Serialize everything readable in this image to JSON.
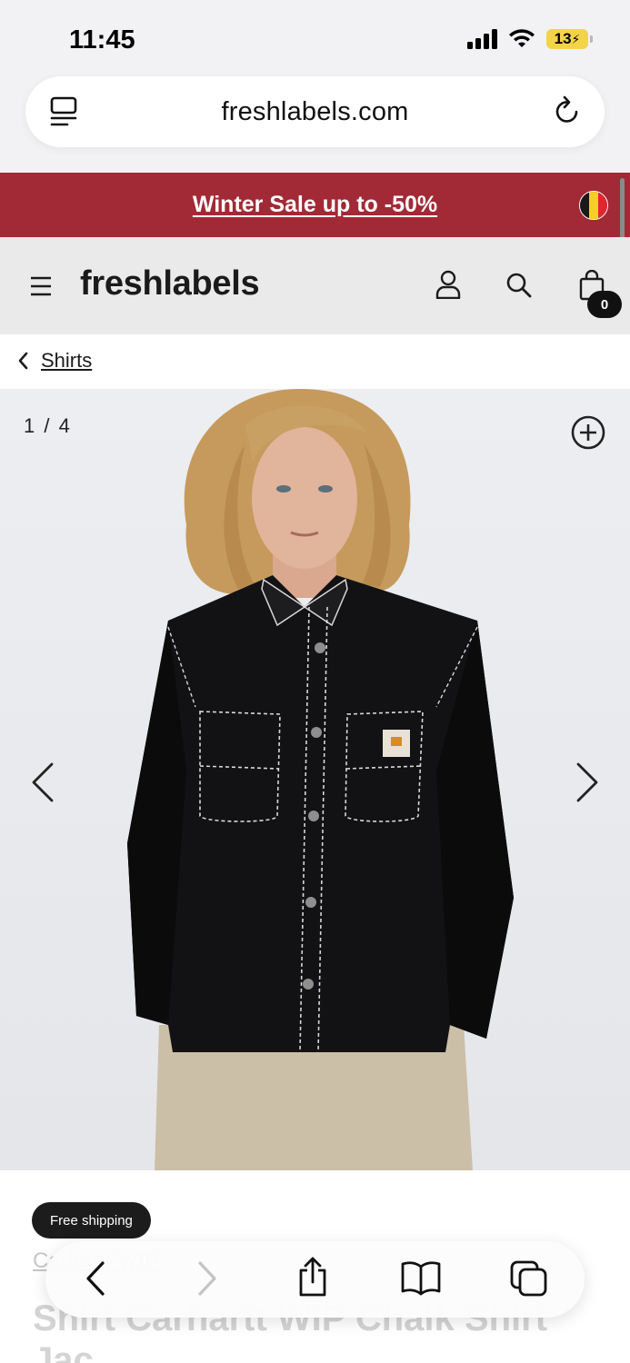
{
  "status_bar": {
    "time": "11:45",
    "battery": "13"
  },
  "browser": {
    "url": "freshlabels.com"
  },
  "promo": {
    "text": "Winter Sale up to -50%",
    "flag_colors": [
      "#1a1a1a",
      "#f5d020",
      "#e0262e"
    ]
  },
  "header": {
    "brand": "freshlabels",
    "cart_count": "0"
  },
  "breadcrumb": {
    "label": "Shirts"
  },
  "gallery": {
    "counter": "1 / 4"
  },
  "product": {
    "badge": "Free shipping",
    "brand": "Carhartt WIP",
    "title": "Shirt Carhartt WIP Chalk Shirt Jac"
  },
  "colors": {
    "promo_bg": "#a12a36",
    "header_bg": "#eaeaea",
    "accent_dark": "#1c1c1c",
    "battery": "#f3d449"
  }
}
